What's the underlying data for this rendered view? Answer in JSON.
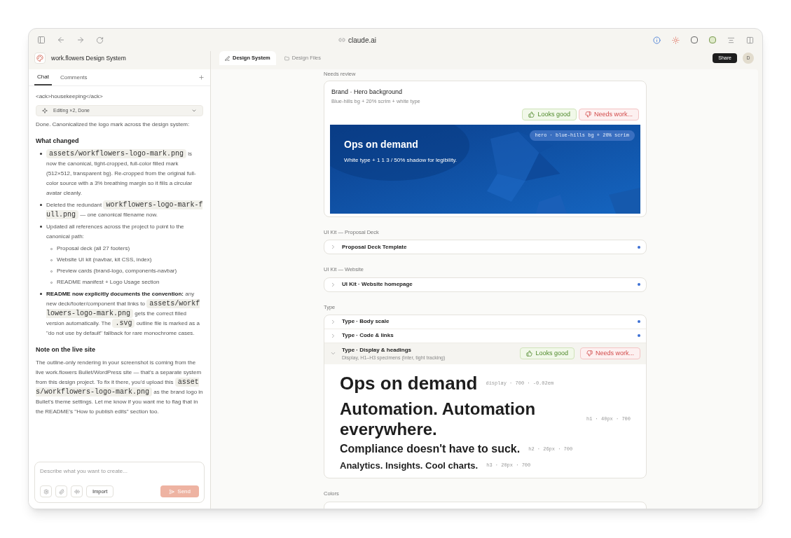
{
  "browser": {
    "url": "claude.ai"
  },
  "project": {
    "title": "work.flowers Design System"
  },
  "panel_tabs": [
    {
      "label": "Chat",
      "selected": true
    },
    {
      "label": "Comments",
      "selected": false
    }
  ],
  "chat": {
    "ack": "<ack>housekeeping</ack>",
    "tool_chip": {
      "label": "Editing ×2, Done",
      "expanded": false
    },
    "intro": "Done. Canonicalized the logo mark across the design system:",
    "heading_1": "What changed",
    "bullets": [
      {
        "segments": [
          {
            "kind": "code",
            "text": "assets/workflowers-logo-mark.png"
          },
          {
            "kind": "text",
            "text": " is now the canonical, tight-cropped, full-color filled mark (512×512, transparent bg). Re-cropped from the original full-color source with a 3% breathing margin so it fills a circular avatar cleanly."
          }
        ]
      },
      {
        "segments": [
          {
            "kind": "text",
            "text": "Deleted the redundant "
          },
          {
            "kind": "code",
            "text": "workflowers-logo-mark-full.png"
          },
          {
            "kind": "text",
            "text": " — one canonical filename now."
          }
        ]
      },
      {
        "segments": [
          {
            "kind": "text",
            "text": "Updated all references across the project to point to the canonical path:"
          }
        ],
        "children": [
          "Proposal deck (all 27 footers)",
          "Website UI kit (navbar, kit CSS, index)",
          "Preview cards (brand-logo, components-navbar)",
          "README manifest + Logo Usage section"
        ]
      },
      {
        "segments": [
          {
            "kind": "text",
            "text": "**README now explicitly documents the convention:** any new deck/footer/component that links to "
          },
          {
            "kind": "code",
            "text": "assets/workflowers-logo-mark.png"
          },
          {
            "kind": "text",
            "text": " gets the correct filled version automatically. The "
          },
          {
            "kind": "code",
            "text": ".svg"
          },
          {
            "kind": "text",
            "text": " outline file is marked as a \"do not use by default\" fallback for rare monochrome cases."
          }
        ]
      }
    ],
    "heading_2": "Note on the live site",
    "note": [
      {
        "kind": "text",
        "text": "The outline-only rendering in your screenshot is coming from the live work.flowers Bullet/WordPress site — that's a separate system from this design project. To fix it there, you'd upload this "
      },
      {
        "kind": "code",
        "text": "assets/workflowers-logo-mark.png"
      },
      {
        "kind": "text",
        "text": " as the brand logo in Bullet's theme settings. Let me know if you want me to flag that in the README's \"How to publish edits\" section too."
      }
    ]
  },
  "composer": {
    "placeholder": "Describe what you want to create...",
    "import_label": "Import",
    "send_label": "Send",
    "send_disabled": true
  },
  "view_tabs": [
    {
      "label": "Design System",
      "selected": true
    },
    {
      "label": "Design Files",
      "selected": false
    }
  ],
  "share_label": "Share",
  "avatar": "D",
  "review": {
    "heading": "Needs review",
    "title": "Brand · Hero background",
    "subtitle": "Blue-hills bg + 20% scrim + white type",
    "good_label": "Looks good",
    "work_label": "Needs work...",
    "hero": {
      "kind": "picture",
      "title": "Ops on demand",
      "text": "White type + 1 1 3 / 50% shadow for legibility.",
      "tag": "hero · blue-hills bg + 20% scrim"
    }
  },
  "sections": [
    {
      "heading": "UI Kit — Proposal Deck",
      "rows": [
        {
          "title": "Proposal Deck Template",
          "expanded": false,
          "color": "#3b6fd4"
        }
      ]
    },
    {
      "heading": "UI Kit — Website",
      "rows": [
        {
          "title": "UI Kit · Website homepage",
          "expanded": false,
          "color": "#3b6fd4"
        }
      ]
    },
    {
      "heading": "Type",
      "rows": [
        {
          "title": "Type · Body scale",
          "expanded": false,
          "color": "#3b6fd4"
        },
        {
          "title": "Type · Code & links",
          "expanded": false,
          "color": "#3b6fd4"
        },
        {
          "title": "Type · Display & headings",
          "subtitle": "Display, H1–H3 specimens (Inter, tight tracking)",
          "expanded": true,
          "good_label": "Looks good",
          "work_label": "Needs work...",
          "specimens": [
            {
              "kind": "display",
              "text": "Ops on demand",
              "meta": "display · 700 · -0.02em"
            },
            {
              "kind": "h1",
              "text": "Automation. Automation everywhere.",
              "meta": "h1 · 40px · 700"
            },
            {
              "kind": "h2",
              "text": "Compliance doesn't have to suck.",
              "meta": "h2 · 26px · 700"
            },
            {
              "kind": "h3",
              "text": "Analytics. Insights. Cool charts.",
              "meta": "h3 · 20px · 700"
            }
          ]
        }
      ]
    },
    {
      "heading": "Colors"
    }
  ]
}
